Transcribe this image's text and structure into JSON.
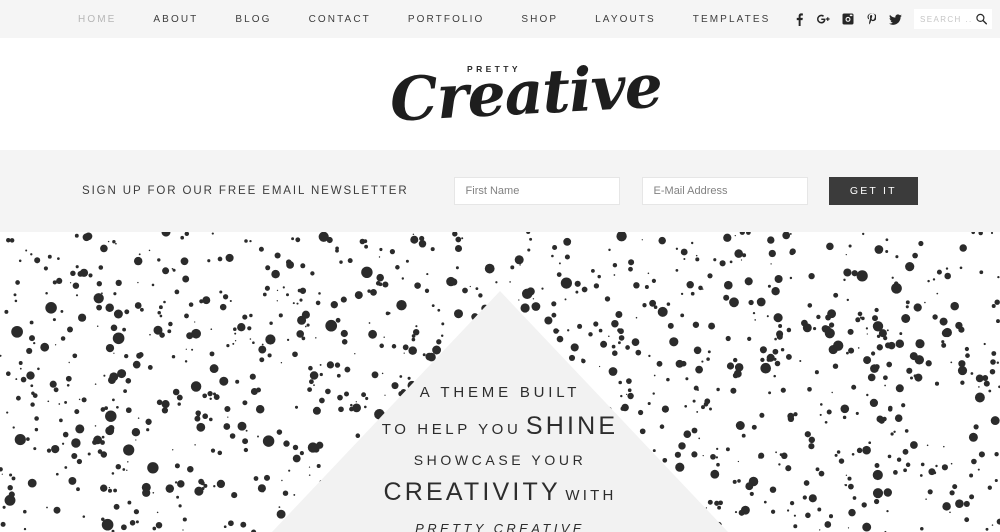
{
  "nav": {
    "items": [
      {
        "label": "Home",
        "active": true
      },
      {
        "label": "About",
        "active": false
      },
      {
        "label": "Blog",
        "active": false
      },
      {
        "label": "Contact",
        "active": false
      },
      {
        "label": "Portfolio",
        "active": false
      },
      {
        "label": "Shop",
        "active": false
      },
      {
        "label": "Layouts",
        "active": false
      },
      {
        "label": "Templates",
        "active": false
      }
    ],
    "social": [
      {
        "name": "facebook-icon",
        "title": "Facebook"
      },
      {
        "name": "google-plus-icon",
        "title": "Google Plus"
      },
      {
        "name": "instagram-icon",
        "title": "Instagram"
      },
      {
        "name": "pinterest-icon",
        "title": "Pinterest"
      },
      {
        "name": "twitter-icon",
        "title": "Twitter"
      }
    ],
    "search": {
      "placeholder": "SEARCH ...",
      "value": ""
    }
  },
  "logo": {
    "eyebrow": "PRETTY",
    "script": "Creative"
  },
  "newsletter": {
    "title": "SIGN UP FOR OUR FREE EMAIL NEWSLETTER",
    "first_name_placeholder": "First Name",
    "first_name_value": "",
    "email_placeholder": "E-Mail Address",
    "email_value": "",
    "submit_label": "GET IT"
  },
  "hero": {
    "line1": "A THEME BUILT",
    "line2_small": "TO HELP YOU",
    "line2_big": "SHINE",
    "line3": "SHOWCASE YOUR",
    "line4_big": "CREATIVITY",
    "line4_small": "WITH",
    "line5": "PRETTY CREATIVE"
  },
  "colors": {
    "nav_background": "#f5f5f5",
    "newsletter_background": "#f4f4f4",
    "button_background": "#3b3b3b",
    "text_dark": "#2d2d2d",
    "text_muted": "#b6b6b6",
    "dot_color": "#2b2b2b",
    "triangle_fill": "#f2f2f2"
  }
}
